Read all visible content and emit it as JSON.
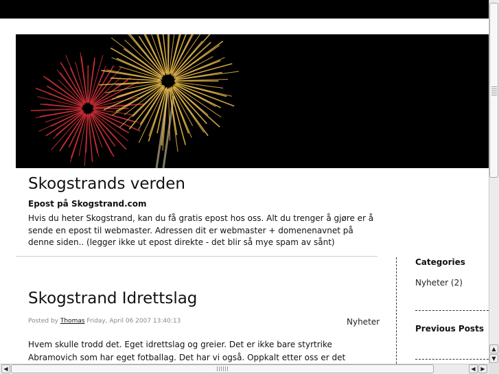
{
  "site": {
    "title": "Skogstrands verden",
    "intro_heading": "Epost på Skogstrand.com",
    "intro_text": "Hvis du heter Skogstrand, kan du få gratis epost hos oss. Alt du trenger å gjøre er å sende en epost til webmaster. Adressen dit er webmaster + domenenavnet på denne siden.. (legger ikke ut epost direkte - det blir så mye spam av sånt)"
  },
  "sidebar": {
    "categories_heading": "Categories",
    "categories": [
      {
        "label": "Nyheter (2)"
      }
    ],
    "previous_heading": "Previous Posts"
  },
  "post": {
    "title": "Skogstrand Idrettslag",
    "posted_by_label": "Posted by",
    "author": "Thomas",
    "date": "Friday, April 06 2007 13:40:13",
    "category": "Nyheter",
    "body": "Hvem skulle trodd det. Eget idrettslag og greier. Det er ikke bare styrtrike Abramovich som har eget fotballag. Det har vi også. Oppkalt etter oss er det også..",
    "help_glyph": "?"
  },
  "icons": {
    "scroll_up": "arrow-up-icon",
    "scroll_down": "arrow-down-icon",
    "scroll_left": "arrow-left-icon",
    "scroll_right": "arrow-right-icon",
    "help": "question-icon"
  },
  "colors": {
    "banner_bg": "#000000",
    "firework_red": "#d8313a",
    "firework_gold": "#f2c14e",
    "help_icon": "#3a6fcf"
  }
}
